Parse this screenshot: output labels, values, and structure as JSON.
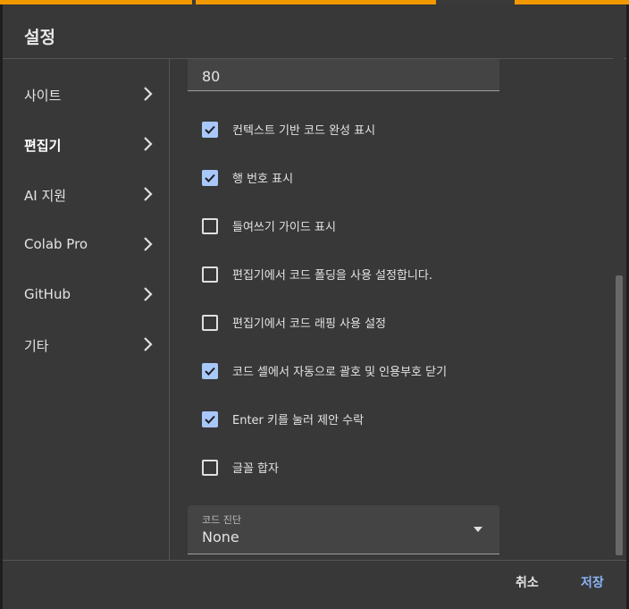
{
  "dialog": {
    "title": "설정",
    "sidebar": {
      "items": [
        {
          "label": "사이트",
          "active": false
        },
        {
          "label": "편집기",
          "active": true
        },
        {
          "label": "AI 지원",
          "active": false
        },
        {
          "label": "Colab Pro",
          "active": false
        },
        {
          "label": "GitHub",
          "active": false
        },
        {
          "label": "기타",
          "active": false
        }
      ]
    },
    "content": {
      "top_field": {
        "value": "80"
      },
      "checkboxes": [
        {
          "label": "컨텍스트 기반 코드 완성 표시",
          "checked": true
        },
        {
          "label": "행 번호 표시",
          "checked": true
        },
        {
          "label": "들여쓰기 가이드 표시",
          "checked": false
        },
        {
          "label": "편집기에서 코드 폴딩을 사용 설정합니다.",
          "checked": false
        },
        {
          "label": "편집기에서 코드 래핑 사용 설정",
          "checked": false
        },
        {
          "label": "코드 셀에서 자동으로 괄호 및 인용부호 닫기",
          "checked": true
        },
        {
          "label": "Enter 키를 눌러 제안 수락",
          "checked": true
        },
        {
          "label": "글꼴 합자",
          "checked": false
        }
      ],
      "diagnostics_select": {
        "label": "코드 진단",
        "value": "None"
      }
    },
    "footer": {
      "cancel_label": "취소",
      "save_label": "저장"
    }
  },
  "colors": {
    "accent": "#8ab4f8",
    "checkbox_checked": "#a8c7fa",
    "top_strip": "#f29900"
  }
}
